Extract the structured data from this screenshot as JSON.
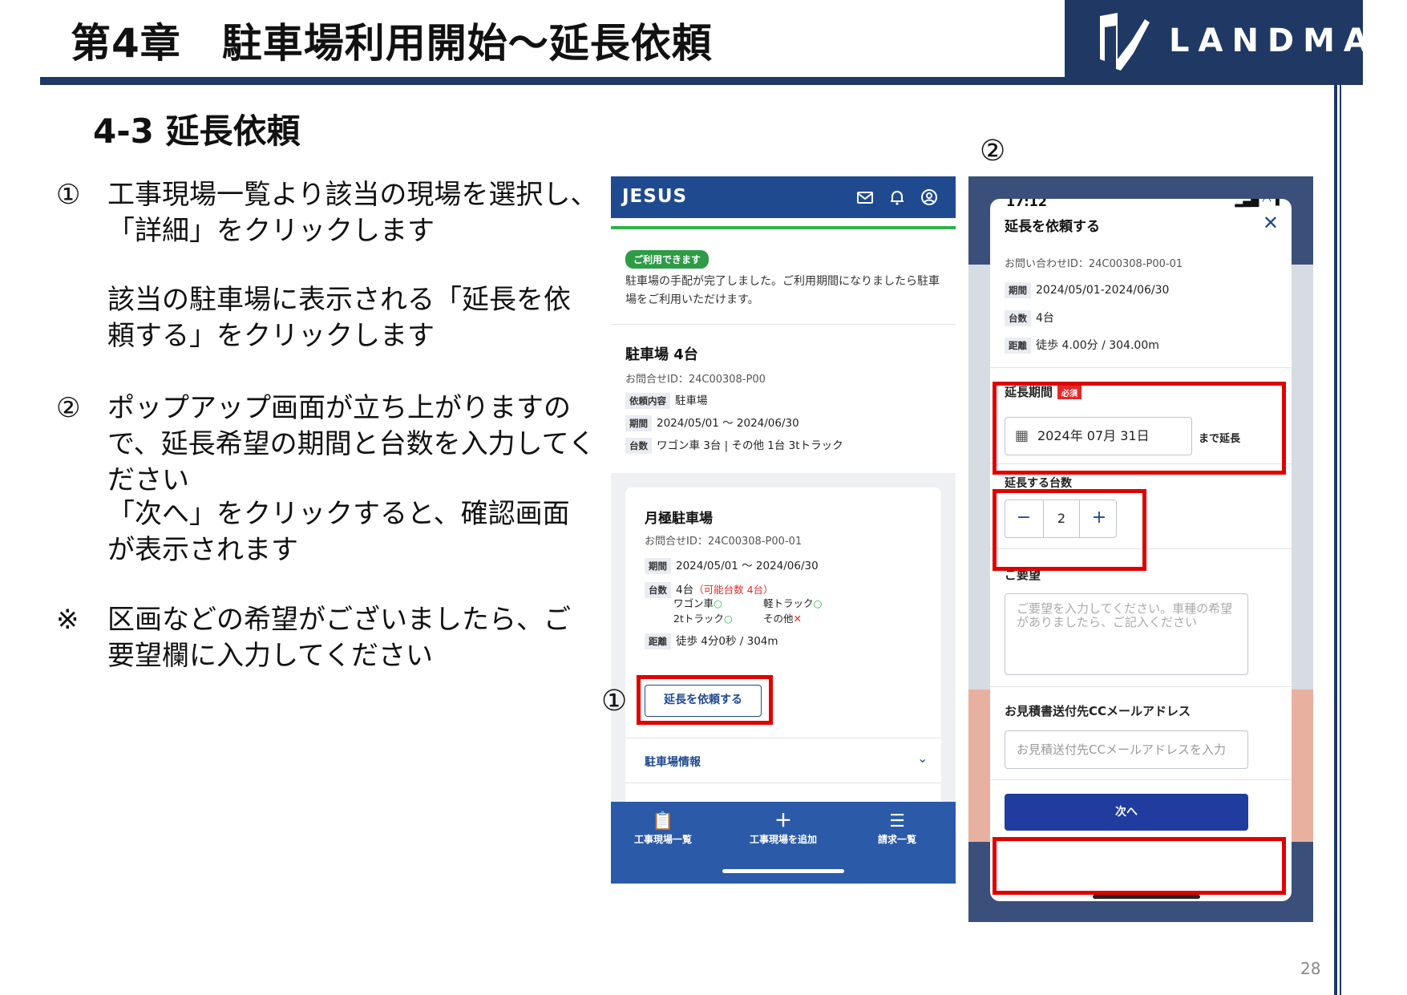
{
  "slide": {
    "title": "第4章　駐車場利用開始～延長依頼",
    "section": "4-3 延長依頼",
    "logo_text": "LANDMARK",
    "page_number": "28"
  },
  "instructions": {
    "n1": "①",
    "s1a": "工事現場一覧より該当の現場を選択し、「詳細」をクリックします",
    "s1b": "該当の駐車場に表示される「延長を依頼する」をクリックします",
    "n2": "②",
    "s2a": "ポップアップ画面が立ち上がりますので、延長希望の期間と台数を入力してください",
    "s2b": "「次へ」をクリックすると、確認画面が表示されます",
    "n3": "※",
    "s3": "区画などの希望がございましたら、ご要望欄に入力してください"
  },
  "callouts": {
    "c1": "①",
    "c2": "②"
  },
  "phone1": {
    "logo": "JESUS",
    "icons": [
      "mail-icon",
      "bell-icon",
      "account-icon"
    ],
    "status_badge": "ご利用できます",
    "message": "駐車場の手配が完了しました。ご利用期間になりましたら駐車場をご利用いただけます。",
    "request": {
      "title": "駐車場 4台",
      "inquiry_id": "お問合せID：24C00308-P00",
      "content_tag": "依頼内容",
      "content": "駐車場",
      "period_tag": "期間",
      "period": "2024/05/01 ～ 2024/06/30",
      "count_tag": "台数",
      "count": "ワゴン車 3台 | その他 1台 3tトラック"
    },
    "card": {
      "title": "月極駐車場",
      "inquiry_id": "お問合せID：24C00308-P00-01",
      "period_tag": "期間",
      "period": "2024/05/01 ～ 2024/06/30",
      "count_tag": "台数",
      "count": "4台",
      "available": "（可能台数 4台）",
      "vehicles": [
        {
          "label": "ワゴン車",
          "mark": "○",
          "color": "#2eb24b"
        },
        {
          "label": "軽トラック",
          "mark": "○",
          "color": "#2eb24b"
        },
        {
          "label": "2tトラック",
          "mark": "○",
          "color": "#2eb24b"
        },
        {
          "label": "その他",
          "mark": "✕",
          "color": "#e02a2a"
        }
      ],
      "distance_tag": "距離",
      "distance": "徒歩 4分0秒 / 304m",
      "extend_button": "延長を依頼する",
      "info_link": "駐車場情報"
    },
    "footer": [
      {
        "icon": "clipboard-icon",
        "glyph": "📋",
        "label": "工事現場一覧"
      },
      {
        "icon": "plus-icon",
        "glyph": "＋",
        "label": "工事現場を追加"
      },
      {
        "icon": "list-icon",
        "glyph": "☰",
        "label": "請求一覧"
      }
    ]
  },
  "phone2": {
    "status_time": "17:12",
    "modal_title": "延長を依頼する",
    "inquiry_id": "お問い合わせID：24C00308-P00-01",
    "period_tag": "期間",
    "period": "2024/05/01-2024/06/30",
    "count_tag": "台数",
    "count": "4台",
    "distance_tag": "距離",
    "distance": "徒歩 4.00分 / 304.00m",
    "extension_label": "延長期間",
    "required": "必須",
    "extension_date": "2024年 07月 31日",
    "until_label": "まで延長",
    "count_label": "延長する台数",
    "count_value": "2",
    "minus": "−",
    "plus": "+",
    "request_label": "ご要望",
    "request_placeholder": "ご要望を入力してください。車種の希望がありましたら、ご記入ください",
    "email_label": "お見積書送付先CCメールアドレス",
    "email_placeholder": "お見積送付先CCメールアドレスを入力",
    "next_button": "次へ"
  },
  "colors": {
    "navy": "#1f3864",
    "app_blue": "#1f4a8f",
    "highlight_red": "#e00000",
    "green": "#2eb24b"
  }
}
